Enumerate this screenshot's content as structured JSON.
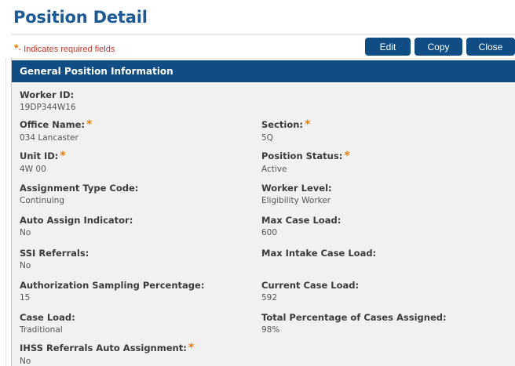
{
  "page": {
    "title": "Position Detail",
    "required_star": "*",
    "required_note": "- Indicates required fields"
  },
  "toolbar": {
    "edit_label": "Edit",
    "copy_label": "Copy",
    "close_label": "Close"
  },
  "section": {
    "title": "General Position Information"
  },
  "fields": {
    "worker_id": {
      "label": "Worker ID:",
      "value": "19DP344W16"
    },
    "office_name": {
      "label": "Office Name:",
      "value": "034 Lancaster",
      "required": "*"
    },
    "section": {
      "label": "Section:",
      "value": "5Q",
      "required": "*"
    },
    "unit_id": {
      "label": "Unit ID:",
      "value": "4W 00",
      "required": "*"
    },
    "position_status": {
      "label": "Position Status:",
      "value": "Active",
      "required": "*"
    },
    "assignment_type_code": {
      "label": "Assignment Type Code:",
      "value": "Continuing"
    },
    "worker_level": {
      "label": "Worker Level:",
      "value": "Eligibility Worker"
    },
    "auto_assign_indicator": {
      "label": "Auto Assign Indicator:",
      "value": "No"
    },
    "max_case_load": {
      "label": "Max Case Load:",
      "value": "600"
    },
    "ssi_referrals": {
      "label": "SSI Referrals:",
      "value": "No"
    },
    "max_intake_case_load": {
      "label": "Max Intake Case Load:",
      "value": ""
    },
    "authorization_sampling_percentage": {
      "label": "Authorization Sampling Percentage:",
      "value": "15"
    },
    "current_case_load": {
      "label": "Current Case Load:",
      "value": "592"
    },
    "case_load": {
      "label": "Case Load:",
      "value": "Traditional"
    },
    "total_percentage_cases_assigned": {
      "label": "Total Percentage of Cases Assigned:",
      "value": "98%"
    },
    "ihss_referrals_auto_assignment": {
      "label": "IHSS Referrals Auto Assignment:",
      "value": "No",
      "required": "*"
    }
  },
  "colors": {
    "title": "#1d5a95",
    "button_bg": "#0f4d84",
    "header_bg": "#0f4d84",
    "required_star": "#e87e04",
    "required_note": "#c0392b",
    "panel_bg": "#f1f1f1"
  }
}
